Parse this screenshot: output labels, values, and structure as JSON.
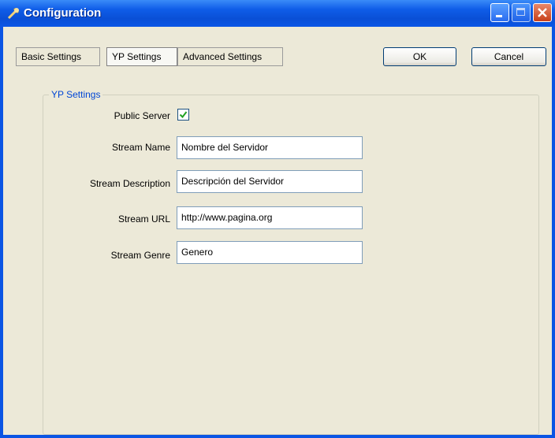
{
  "window": {
    "title": "Configuration",
    "icon": "gear-icon",
    "controls": [
      "minimize-icon",
      "maximize-icon",
      "close-icon"
    ]
  },
  "tabs": [
    {
      "label": "Basic Settings",
      "active": false
    },
    {
      "label": "YP Settings",
      "active": true
    },
    {
      "label": "Advanced Settings",
      "active": false
    }
  ],
  "buttons": {
    "ok": "OK",
    "cancel": "Cancel"
  },
  "group": {
    "label": "YP Settings"
  },
  "fields": {
    "public_server": {
      "label": "Public Server",
      "checked": true
    },
    "stream_name": {
      "label": "Stream Name",
      "value": "Nombre del Servidor"
    },
    "stream_description": {
      "label": "Stream Description",
      "value": "Descripción del Servidor"
    },
    "stream_url": {
      "label": "Stream URL",
      "value": "http://www.pagina.org"
    },
    "stream_genre": {
      "label": "Stream Genre",
      "value": "Genero"
    }
  },
  "colors": {
    "titlebar": "#0b55e4",
    "client": "#ece9d8",
    "group_label": "#0046d5"
  }
}
